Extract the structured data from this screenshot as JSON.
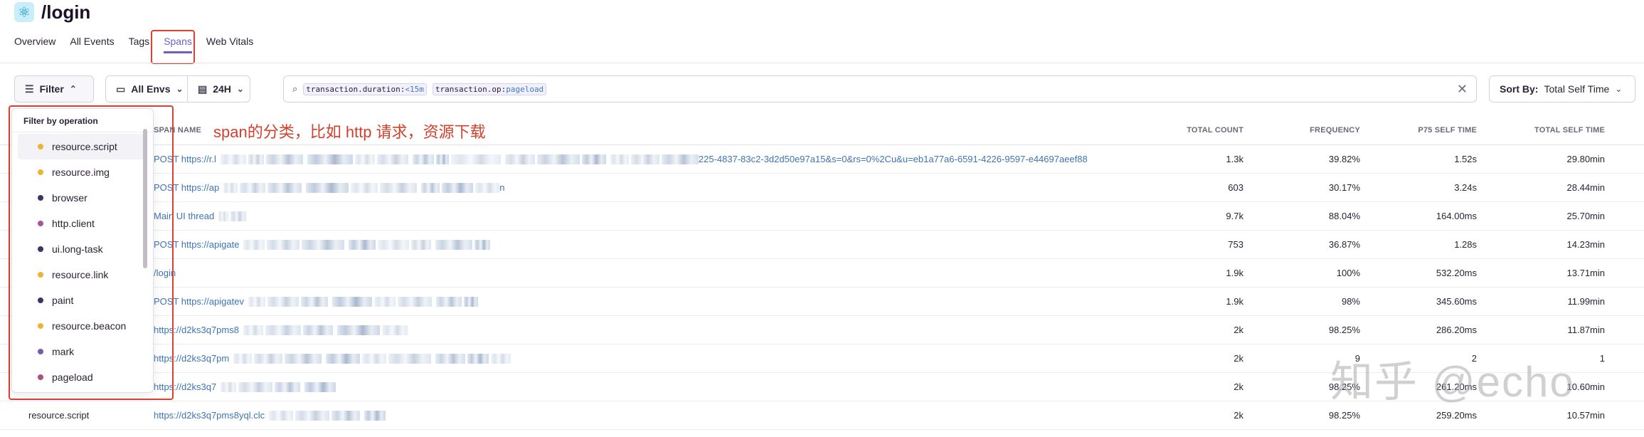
{
  "page": {
    "title": "/login",
    "logo_icon": "atom-icon"
  },
  "tabs": [
    {
      "label": "Overview",
      "active": false
    },
    {
      "label": "All Events",
      "active": false
    },
    {
      "label": "Tags",
      "active": false
    },
    {
      "label": "Spans",
      "active": true
    },
    {
      "label": "Web Vitals",
      "active": false
    }
  ],
  "filters": {
    "filter_label": "Filter",
    "env_label": "All Envs",
    "period_label": "24H",
    "search_tokens": [
      {
        "key": "transaction.duration:",
        "value": "<15m"
      },
      {
        "key": "transaction.op:",
        "value": "pageload"
      }
    ],
    "sort_prefix": "Sort By:",
    "sort_value": "Total Self Time"
  },
  "dropdown": {
    "header": "Filter by operation",
    "items": [
      {
        "label": "resource.script",
        "color": "#e9b43a"
      },
      {
        "label": "resource.img",
        "color": "#e9b43a"
      },
      {
        "label": "browser",
        "color": "#3b3560"
      },
      {
        "label": "http.client",
        "color": "#a5579e"
      },
      {
        "label": "ui.long-task",
        "color": "#3b3560"
      },
      {
        "label": "resource.link",
        "color": "#e9b43a"
      },
      {
        "label": "paint",
        "color": "#3b3560"
      },
      {
        "label": "resource.beacon",
        "color": "#e9b43a"
      },
      {
        "label": "mark",
        "color": "#7a5aa6"
      },
      {
        "label": "pageload",
        "color": "#b24c84"
      }
    ]
  },
  "annotation": "span的分类，比如 http 请求，资源下载",
  "table": {
    "headers": {
      "name": "SPAN NAME",
      "count": "TOTAL COUNT",
      "frequency": "FREQUENCY",
      "p75": "P75 SELF TIME",
      "total": "TOTAL SELF TIME"
    },
    "rows": [
      {
        "op": "",
        "name_start": "POST https://r.l",
        "name_end": "225-4837-83c2-3d2d50e97a15&s=0&rs=0%2Cu&u=eb1a77a6-6591-4226-9597-e44697aeef88",
        "count": "1.3k",
        "frequency": "39.82%",
        "p75": "1.52s",
        "total": "29.80min"
      },
      {
        "op": "",
        "name_start": "POST https://ap",
        "name_end": "n",
        "count": "603",
        "frequency": "30.17%",
        "p75": "3.24s",
        "total": "28.44min"
      },
      {
        "op": "",
        "name_start": "Main UI thread",
        "name_end": "",
        "count": "9.7k",
        "frequency": "88.04%",
        "p75": "164.00ms",
        "total": "25.70min"
      },
      {
        "op": "",
        "name_start": "POST https://apigate",
        "name_end": "",
        "count": "753",
        "frequency": "36.87%",
        "p75": "1.28s",
        "total": "14.23min"
      },
      {
        "op": "",
        "name_start": "/login",
        "name_end": "",
        "count": "1.9k",
        "frequency": "100%",
        "p75": "532.20ms",
        "total": "13.71min"
      },
      {
        "op": "",
        "name_start": "POST https://apigatev",
        "name_end": "",
        "count": "1.9k",
        "frequency": "98%",
        "p75": "345.60ms",
        "total": "11.99min"
      },
      {
        "op": "",
        "name_start": "https://d2ks3q7pms8",
        "name_end": "",
        "count": "2k",
        "frequency": "98.25%",
        "p75": "286.20ms",
        "total": "11.87min"
      },
      {
        "op": "",
        "name_start": "https://d2ks3q7pm",
        "name_end": "",
        "count": "2k",
        "frequency": "9",
        "p75": "2",
        "total": "1"
      },
      {
        "op": "",
        "name_start": "https://d2ks3q7",
        "name_end": "",
        "count": "2k",
        "frequency": "98.25%",
        "p75": "261.20ms",
        "total": "10.60min"
      },
      {
        "op": "resource.script",
        "name_start": "https://d2ks3q7pms8yql.clc",
        "name_end": "",
        "count": "2k",
        "frequency": "98.25%",
        "p75": "259.20ms",
        "total": "10.57min"
      }
    ]
  },
  "watermark": "知乎 @echo"
}
